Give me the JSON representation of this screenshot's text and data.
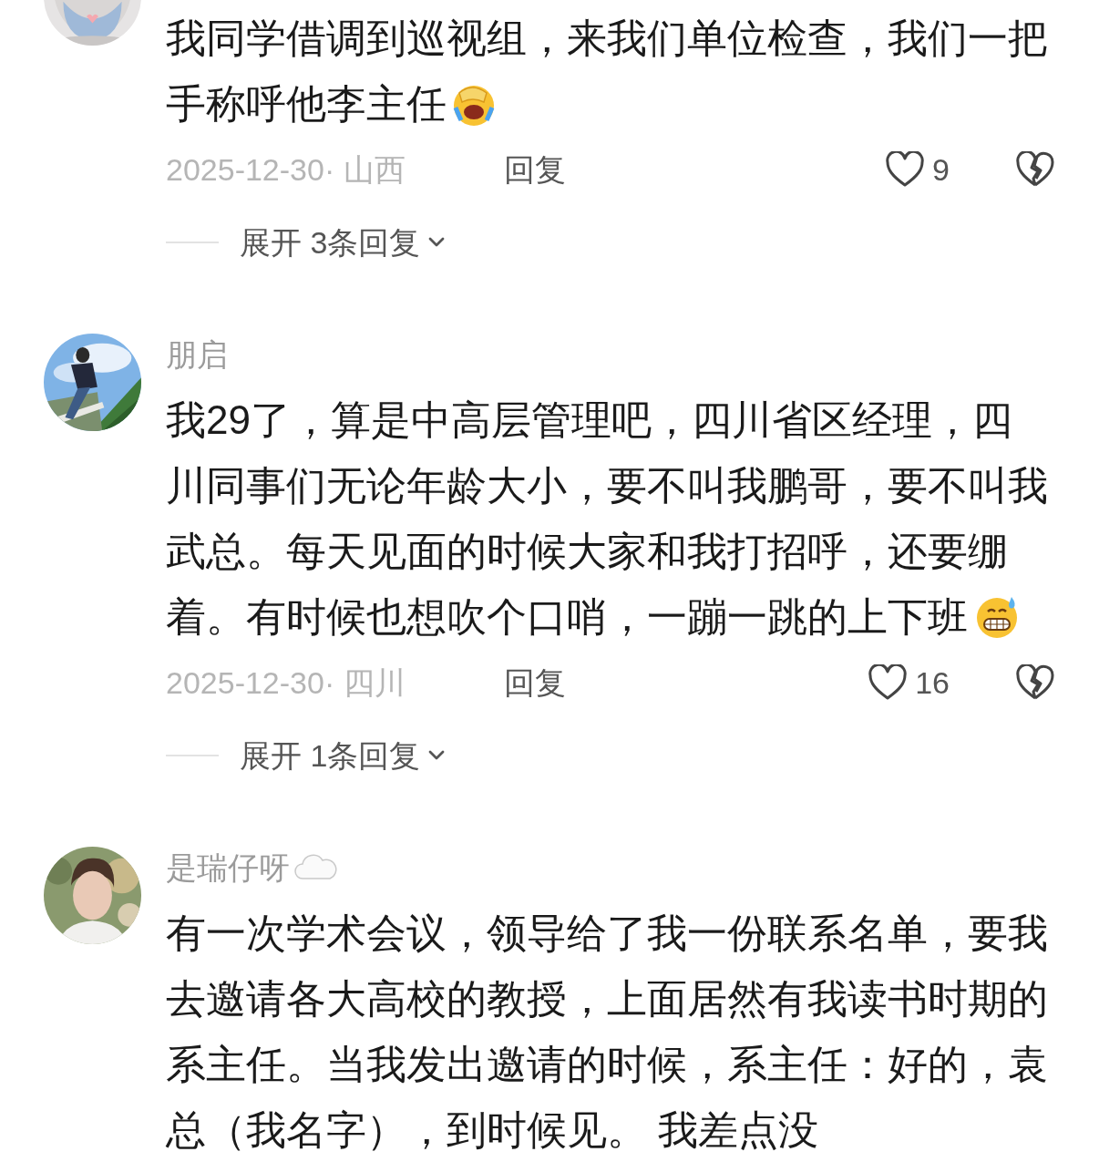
{
  "comments": [
    {
      "body_lines": [
        "我同学借调到巡视组，来我们单位检查，我们一把",
        "手称呼他李主任"
      ],
      "ends_with_emoji": true,
      "date_location": "2025-12-30· 山西",
      "reply": "回复",
      "likes": "9",
      "expand": "展开 3条回复"
    },
    {
      "author": "朋启",
      "body_lines": [
        "我29了，算是中高层管理吧，四川省区经理，四",
        "川同事们无论年龄大小，要不叫我鹏哥，要不叫我",
        "武总。每天见面的时候大家和我打招呼，还要绷",
        "着。有时候也想吹个口哨，一蹦一跳的上下班"
      ],
      "ends_with_emoji": true,
      "date_location": "2025-12-30· 四川",
      "reply": "回复",
      "likes": "16",
      "expand": "展开 1条回复"
    },
    {
      "author": "是瑞仔呀",
      "author_has_badge": true,
      "body_lines": [
        "有一次学术会议，领导给了我一份联系名单，要我",
        "去邀请各大高校的教授，上面居然有我读书时期的",
        "系主任。当我发出邀请的时候，系主任：好的，袁",
        "总（我名字），到时候见。 我差点没"
      ]
    }
  ]
}
